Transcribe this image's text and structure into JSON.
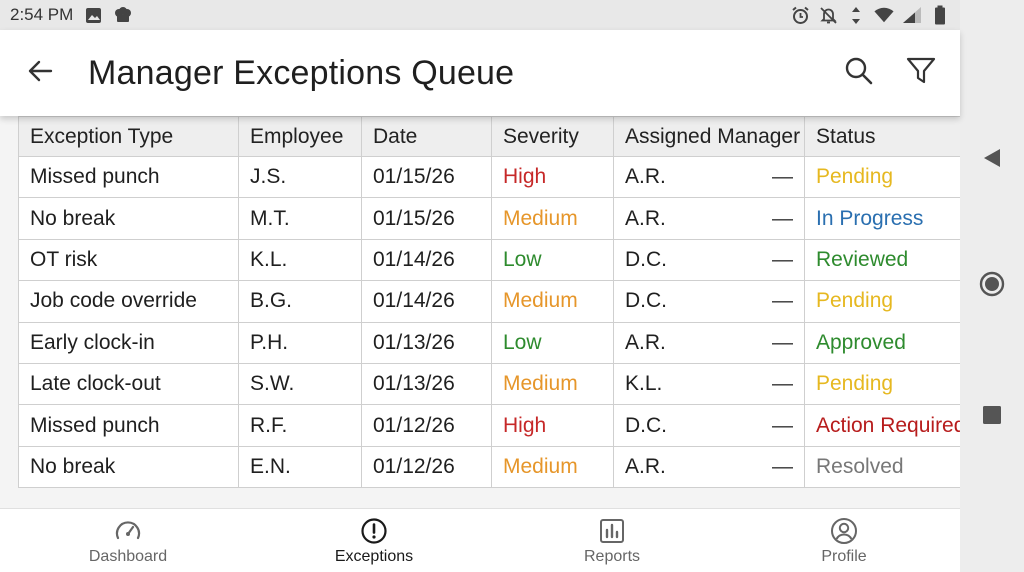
{
  "status_bar": {
    "time": "2:54 PM",
    "left_icons": [
      "image-icon",
      "chef-hat-icon"
    ],
    "right_icons": [
      "alarm-icon",
      "bell-off-icon",
      "data-arrows-icon",
      "wifi-icon",
      "signal-icon",
      "battery-icon"
    ]
  },
  "app_bar": {
    "title": "Manager Exceptions Queue",
    "back_icon": "arrow-left-icon",
    "actions": [
      "search-icon",
      "filter-icon"
    ]
  },
  "table": {
    "headers": [
      "Exception Type",
      "Employee",
      "Date",
      "Severity",
      "Assigned Manager",
      "Status"
    ],
    "rows": [
      {
        "type": "Missed punch",
        "employee": "J.S.",
        "date": "01/15/26",
        "severity": "High",
        "manager": "A.R.",
        "dash": "—",
        "status": "Pending"
      },
      {
        "type": "No break",
        "employee": "M.T.",
        "date": "01/15/26",
        "severity": "Medium",
        "manager": "A.R.",
        "dash": "—",
        "status": "In Progress"
      },
      {
        "type": "OT risk",
        "employee": "K.L.",
        "date": "01/14/26",
        "severity": "Low",
        "manager": "D.C.",
        "dash": "—",
        "status": "Reviewed"
      },
      {
        "type": "Job code override",
        "employee": "B.G.",
        "date": "01/14/26",
        "severity": "Medium",
        "manager": "D.C.",
        "dash": "—",
        "status": "Pending"
      },
      {
        "type": "Early clock-in",
        "employee": "P.H.",
        "date": "01/13/26",
        "severity": "Low",
        "manager": "A.R.",
        "dash": "—",
        "status": "Approved"
      },
      {
        "type": "Late clock-out",
        "employee": "S.W.",
        "date": "01/13/26",
        "severity": "Medium",
        "manager": "K.L.",
        "dash": "—",
        "status": "Pending"
      },
      {
        "type": "Missed punch",
        "employee": "R.F.",
        "date": "01/12/26",
        "severity": "High",
        "manager": "D.C.",
        "dash": "—",
        "status": "Action Required"
      },
      {
        "type": "No break",
        "employee": "E.N.",
        "date": "01/12/26",
        "severity": "Medium",
        "manager": "A.R.",
        "dash": "—",
        "status": "Resolved"
      }
    ]
  },
  "bottom_nav": {
    "items": [
      {
        "label": "Dashboard",
        "icon": "gauge-icon"
      },
      {
        "label": "Exceptions",
        "icon": "alert-circle-icon",
        "active": true
      },
      {
        "label": "Reports",
        "icon": "bar-chart-icon"
      },
      {
        "label": "Profile",
        "icon": "user-circle-icon"
      }
    ]
  },
  "system_nav": [
    "back-triangle-icon",
    "home-circle-icon",
    "recents-square-icon"
  ],
  "colors": {
    "severity_high": "#c62828",
    "severity_medium": "#e6962a",
    "severity_low": "#2e8b2e",
    "status_pending": "#e6b820",
    "status_in_progress": "#2a6fb0",
    "status_reviewed": "#2e8b2e",
    "status_approved": "#2e8b2e",
    "status_action_required": "#b71c1c",
    "status_resolved": "#777777"
  }
}
